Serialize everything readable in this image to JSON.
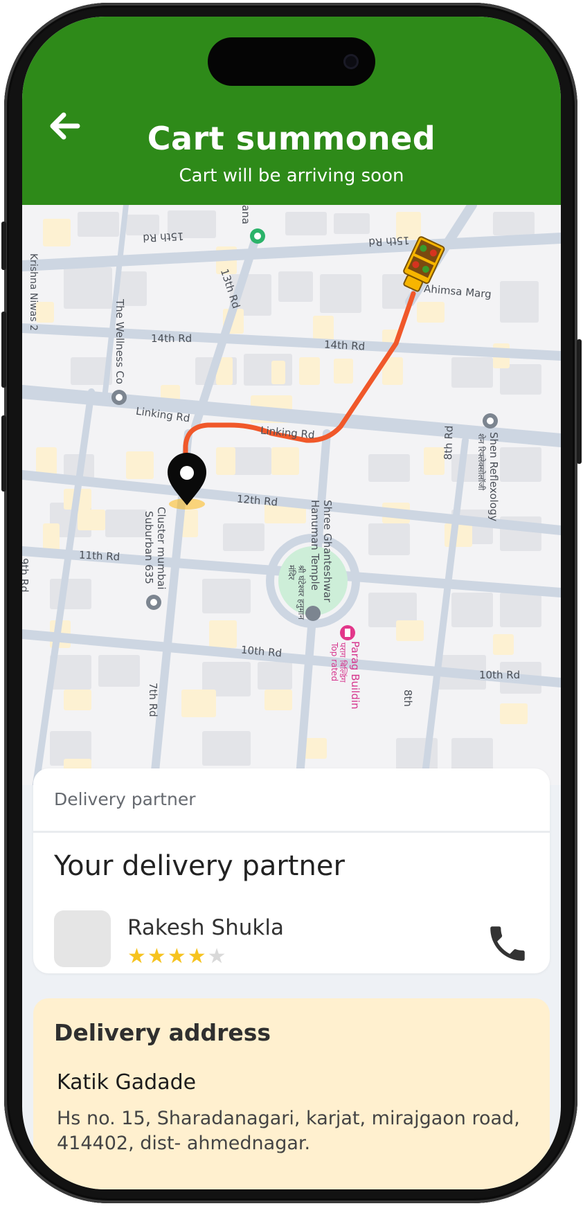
{
  "header": {
    "title": "Cart summoned",
    "subtitle": "Cart will be arriving soon",
    "back_icon": "arrow-left-icon",
    "background_color": "#2e8a19"
  },
  "map": {
    "labels": {
      "krishna_niwas": "Krishna Niwas 2",
      "fifteenth_rd_a": "15th Rd",
      "fifteenth_rd_b": "15th Rd",
      "thirteenth_rd": "13th Rd",
      "wellness_co": "The Wellness Co",
      "fourteenth_rd_a": "14th Rd",
      "fourteenth_rd_b": "14th Rd",
      "ahimsa_marg": "Ahimsa Marg",
      "linking_rd_a": "Linking Rd",
      "linking_rd_b": "Linking Rd",
      "shen_reflexology": "Shen Reflexology",
      "shen_reflexology_hi": "शेन रिफ्लेक्सोलॉजी",
      "eighth_rd_a": "8th Rd",
      "twelfth_rd": "12th Rd",
      "cluster_mumbai": "Cluster mumbai",
      "suburban": "Suburban 635",
      "hanuman_temple": "Shree Ghanteshwar Hanuman Temple",
      "hanuman_temple_hi": "श्री घंटेश्वर हनुमान मंदिर",
      "eleventh_rd": "11th Rd",
      "ninth_rd": "9th Rd",
      "tenth_rd_a": "10th Rd",
      "tenth_rd_b": "10th Rd",
      "seventh_rd": "7th Rd",
      "parag_building": "Parag Buildin",
      "parag_building_hi": "पराग बिल्डिंग",
      "top_rated": "Top rated",
      "eighth_rd_b": "8th",
      "ana": "ana"
    },
    "route_color": "#f0582a",
    "pin_icon": "location-pin-icon",
    "cart_icon": "vegetable-cart-icon"
  },
  "partner_card": {
    "section_label": "Delivery partner",
    "heading": "Your delivery partner",
    "name": "Rakesh Shukla",
    "rating": 4,
    "rating_max": 5,
    "call_icon": "phone-icon"
  },
  "address_card": {
    "heading": "Delivery address",
    "name": "Katik Gadade",
    "address": "Hs no. 15, Sharadanagari, karjat, mirajgaon road, 414402, dist- ahmednagar."
  }
}
